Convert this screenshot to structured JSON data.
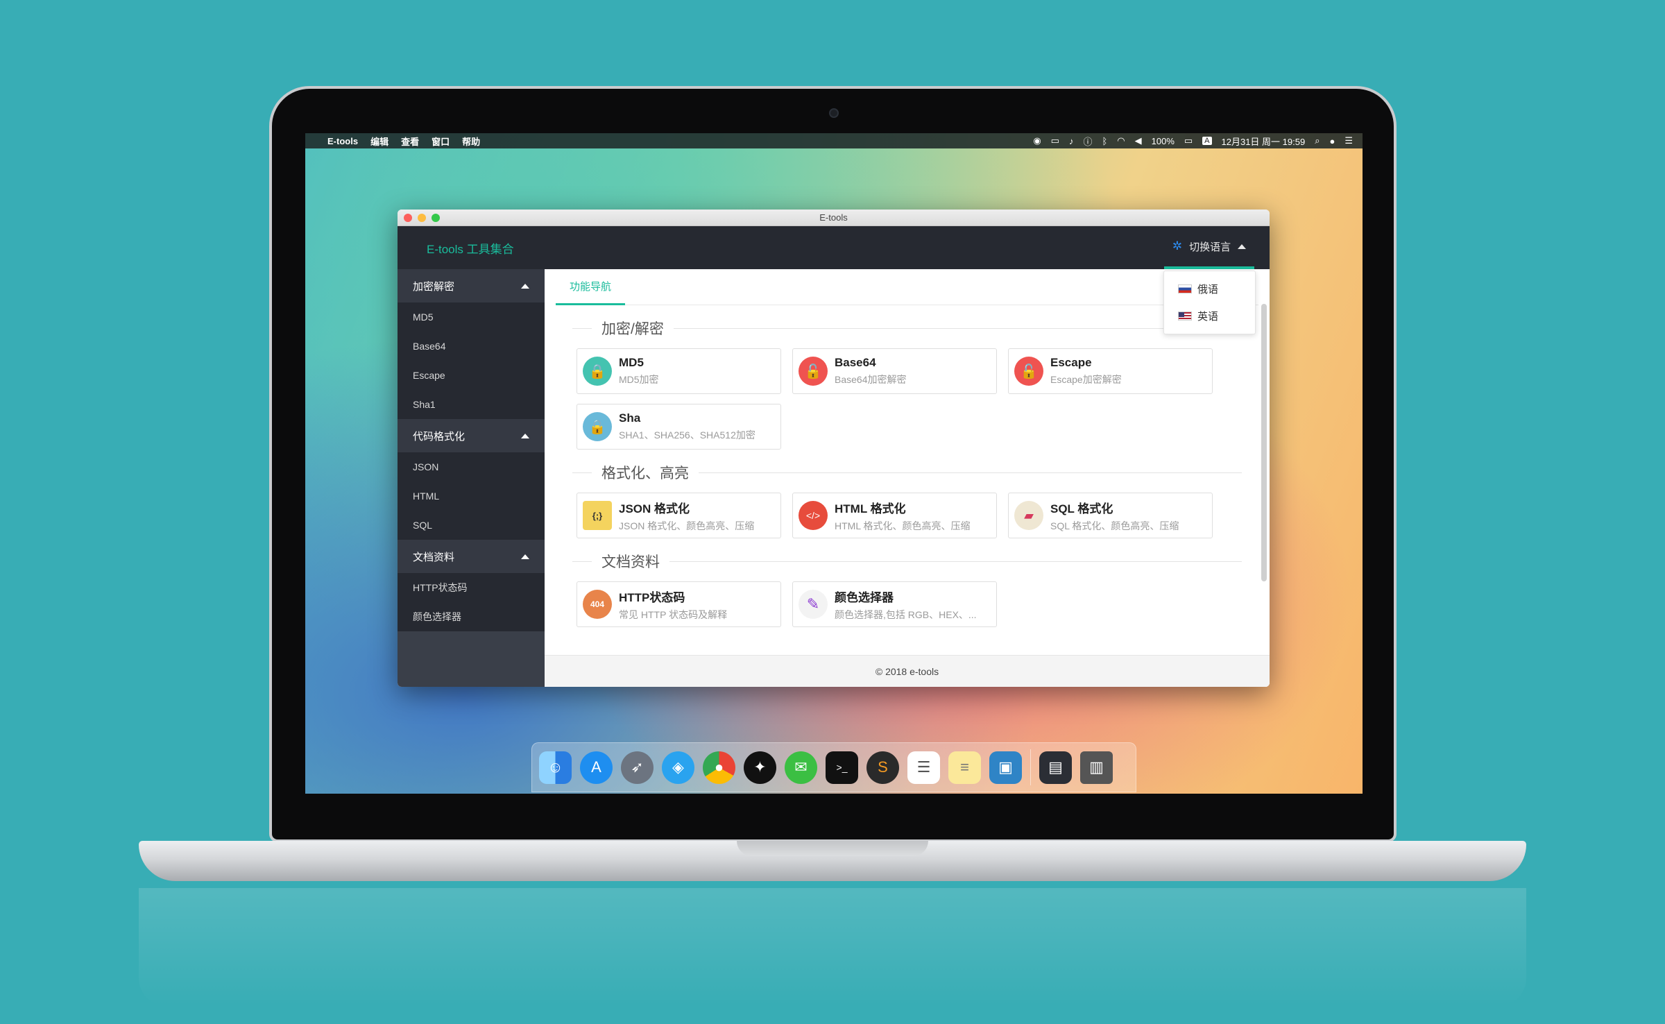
{
  "menubar": {
    "app_name": "E-tools",
    "menus": [
      "编辑",
      "查看",
      "窗口",
      "帮助"
    ],
    "battery": "100%",
    "input_source": "A",
    "datetime": "12月31日 周一 19:59"
  },
  "window": {
    "title": "E-tools"
  },
  "header": {
    "brand": "E-tools 工具集合",
    "language_switch": "切换语言",
    "languages": [
      {
        "label": "俄语",
        "flag": "flag-ru-icon"
      },
      {
        "label": "英语",
        "flag": "flag-us-icon"
      }
    ]
  },
  "sidebar": {
    "groups": [
      {
        "label": "加密解密",
        "items": [
          "MD5",
          "Base64",
          "Escape",
          "Sha1"
        ]
      },
      {
        "label": "代码格式化",
        "items": [
          "JSON",
          "HTML",
          "SQL"
        ]
      },
      {
        "label": "文档资料",
        "items": [
          "HTTP状态码",
          "颜色选择器"
        ]
      }
    ]
  },
  "main": {
    "tab": "功能导航",
    "sections": [
      {
        "title": "加密/解密",
        "cards": [
          {
            "title": "MD5",
            "desc": "MD5加密",
            "icon": "lock-icon"
          },
          {
            "title": "Base64",
            "desc": "Base64加密解密",
            "icon": "unlock-icon"
          },
          {
            "title": "Escape",
            "desc": "Escape加密解密",
            "icon": "unlock-icon"
          },
          {
            "title": "Sha",
            "desc": "SHA1、SHA256、SHA512加密",
            "icon": "lock-icon"
          }
        ]
      },
      {
        "title": "格式化、高亮",
        "cards": [
          {
            "title": "JSON 格式化",
            "desc": "JSON 格式化、颜色高亮、压缩",
            "icon": "json-file-icon",
            "icon_text": "{;}"
          },
          {
            "title": "HTML 格式化",
            "desc": "HTML 格式化、颜色高亮、压缩",
            "icon": "html-code-icon",
            "icon_text": "</>"
          },
          {
            "title": "SQL 格式化",
            "desc": "SQL 格式化、颜色高亮、压缩",
            "icon": "sql-file-icon"
          }
        ]
      },
      {
        "title": "文档资料",
        "cards": [
          {
            "title": "HTTP状态码",
            "desc": "常见 HTTP 状态码及解释",
            "icon": "http-404-icon",
            "icon_text": "404"
          },
          {
            "title": "颜色选择器",
            "desc": "颜色选择器,包括 RGB、HEX、...",
            "icon": "color-picker-icon"
          }
        ]
      }
    ],
    "footer": "© 2018 e-tools"
  },
  "colors": {
    "accent": "#1abc9c",
    "header_bg": "#262931",
    "sidebar_bg": "#3a3f49"
  },
  "dock": {
    "apps": [
      "finder-icon",
      "app-store-icon",
      "launchpad-icon",
      "safari-icon",
      "chrome-icon",
      "qq-icon",
      "wechat-icon",
      "terminal-icon",
      "sublime-text-icon",
      "reminders-icon",
      "notes-icon",
      "virtualbox-icon",
      "e-tools-app-icon",
      "trash-icon"
    ]
  }
}
